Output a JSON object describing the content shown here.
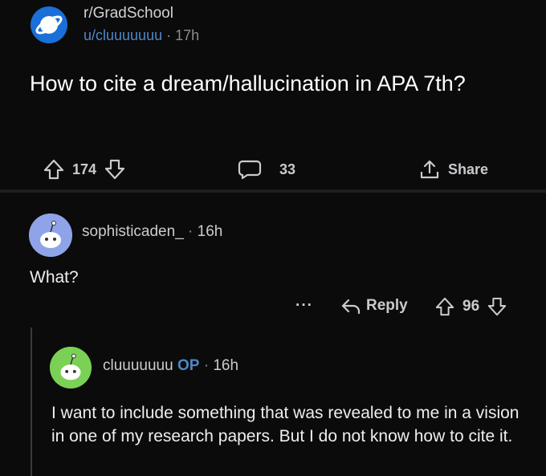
{
  "post": {
    "subreddit": "r/GradSchool",
    "author": "u/cluuuuuuu",
    "separator": "·",
    "age": "17h",
    "title": "How to cite a dream/hallucination in APA 7th?",
    "upvotes": "174",
    "comments": "33",
    "share_label": "Share"
  },
  "comments": [
    {
      "author": "sophisticaden_",
      "separator": "·",
      "age": "16h",
      "body": "What?",
      "more": "···",
      "reply_label": "Reply",
      "score": "96"
    },
    {
      "author": "cluuuuuuu",
      "op_badge": "OP",
      "separator": "·",
      "age": "16h",
      "body": "I want to include something that was revealed to me in a vision in one of my research papers. But I do not know how to cite it."
    }
  ],
  "colors": {
    "background": "#0b0b0b",
    "subreddit_icon": "#1a6fd8",
    "link_blue": "#4f86c6",
    "avatar_1": "#8fa3e8",
    "avatar_2": "#7ad155"
  }
}
